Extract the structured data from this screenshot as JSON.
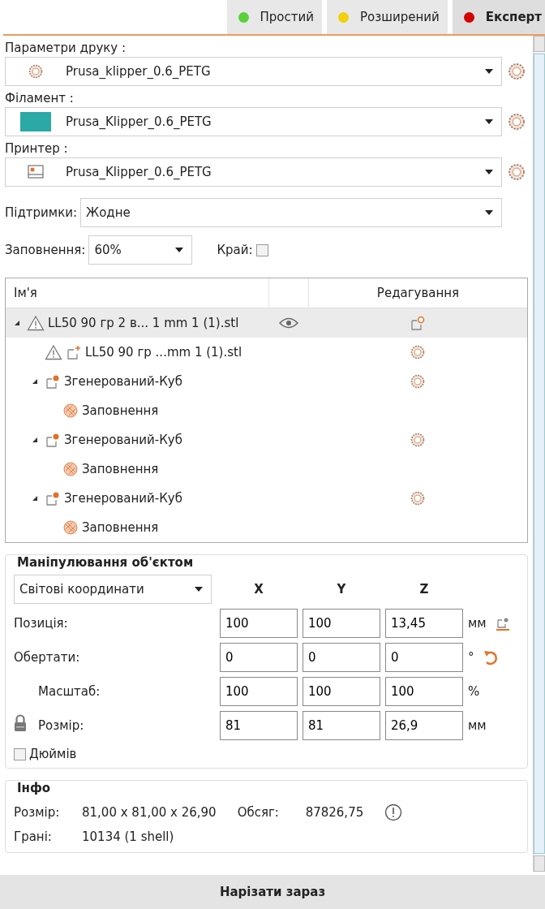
{
  "modes": [
    {
      "label": "Простий",
      "color": "#5ad13b",
      "selected": false
    },
    {
      "label": "Розширений",
      "color": "#f2d00c",
      "selected": false
    },
    {
      "label": "Експерт",
      "color": "#d40000",
      "selected": true
    }
  ],
  "presets": [
    {
      "label": "Параметри друку :",
      "value": "Prusa_klipper_0.6_PETG",
      "kind": "print"
    },
    {
      "label": "Філамент :",
      "value": "Prusa_Klipper_0.6_PETG",
      "kind": "filament",
      "color": "#2aa9a6"
    },
    {
      "label": "Принтер :",
      "value": "Prusa_Klipper_0.6_PETG",
      "kind": "printer"
    }
  ],
  "supports": {
    "label": "Підтримки:",
    "value": "Жодне"
  },
  "infill": {
    "label": "Заповнення:",
    "value": "60%"
  },
  "brim": {
    "label": "Край:",
    "checked": false
  },
  "tree": {
    "columns": [
      "Ім'я",
      "Редагування"
    ],
    "items": [
      {
        "name": "LL50 90 гр 2 в... 1 mm 1 (1).stl",
        "kind": "object",
        "warning": true,
        "selected": true,
        "expanded": true,
        "children": [
          {
            "name": "LL50 90 гр ...mm 1 (1).stl",
            "kind": "part",
            "warning": true,
            "selected": false
          },
          {
            "name": "Згенерований-Куб",
            "kind": "modifier",
            "warning": false,
            "selected": false,
            "expanded": true,
            "children": [
              {
                "name": "Заповнення",
                "kind": "setting",
                "warning": false,
                "selected": false
              }
            ]
          },
          {
            "name": "Згенерований-Куб",
            "kind": "modifier",
            "warning": false,
            "selected": false,
            "expanded": true,
            "children": [
              {
                "name": "Заповнення",
                "kind": "setting",
                "warning": false,
                "selected": false
              }
            ]
          },
          {
            "name": "Згенерований-Куб",
            "kind": "modifier",
            "warning": false,
            "selected": false,
            "expanded": true,
            "children": [
              {
                "name": "Заповнення",
                "kind": "setting",
                "warning": false,
                "selected": false
              }
            ]
          }
        ]
      }
    ]
  },
  "manipulation": {
    "title": "Маніпулювання об'єктом",
    "coordinates": "Світові координати",
    "axes": [
      "X",
      "Y",
      "Z"
    ],
    "rows": [
      {
        "label": "Позиція:",
        "values": [
          "100",
          "100",
          "13,45"
        ],
        "unit": "мм",
        "kind": "position"
      },
      {
        "label": "Обертати:",
        "values": [
          "0",
          "0",
          "0"
        ],
        "unit": "°",
        "kind": "rotation"
      },
      {
        "label": "Масштаб:",
        "values": [
          "100",
          "100",
          "100"
        ],
        "unit": "%",
        "kind": "scale"
      },
      {
        "label": "Розмір:",
        "values": [
          "81",
          "81",
          "26,9"
        ],
        "unit": "мм",
        "kind": "size"
      }
    ],
    "inches": {
      "label": "Дюймів",
      "checked": false
    }
  },
  "info": {
    "title": "Інфо",
    "rows": [
      [
        {
          "label": "Розмір:",
          "value": "81,00 x 81,00 x 26,90"
        },
        {
          "label": "Обсяг:",
          "value": "87826,75"
        }
      ],
      [
        {
          "label": "Грані:",
          "value": "10134 (1 shell)"
        }
      ]
    ]
  },
  "slice_button": "Нарізати зараз"
}
